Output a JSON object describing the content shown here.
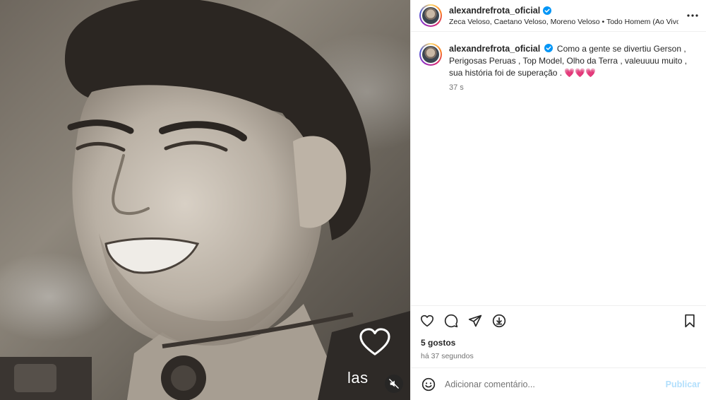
{
  "post": {
    "author": {
      "username": "alexandrefrota_oficial",
      "verified": true,
      "avatar_icon": "profile-avatar"
    },
    "audio_line": "Zeca Veloso, Caetano Veloso, Moreno Veloso • Todo Homem (Ao Vivo) [",
    "caption": {
      "username": "alexandrefrota_oficial",
      "text": "Como a gente se divertiu Gerson , Perigosas Peruas , Top Model, Olho da Terra , valeuuuu muito , sua história foi de superação . 💗💗💗",
      "time": "37 s"
    },
    "media": {
      "overlay_text": "las",
      "overlay_icon": "heart-outline-icon",
      "mute_icon": "muted-speaker-icon"
    },
    "actions": {
      "icons": [
        "heart-icon",
        "comment-icon",
        "share-icon",
        "save-download-icon",
        "bookmark-icon"
      ]
    },
    "likes": "5 gostos",
    "posted_ago": "há 37 segundos",
    "comment_box": {
      "placeholder": "Adicionar comentário...",
      "value": "",
      "publish_label": "Publicar"
    },
    "colors": {
      "verified": "#0095f6",
      "publish_disabled": "#b2dffc",
      "text_secondary": "#737373"
    }
  }
}
